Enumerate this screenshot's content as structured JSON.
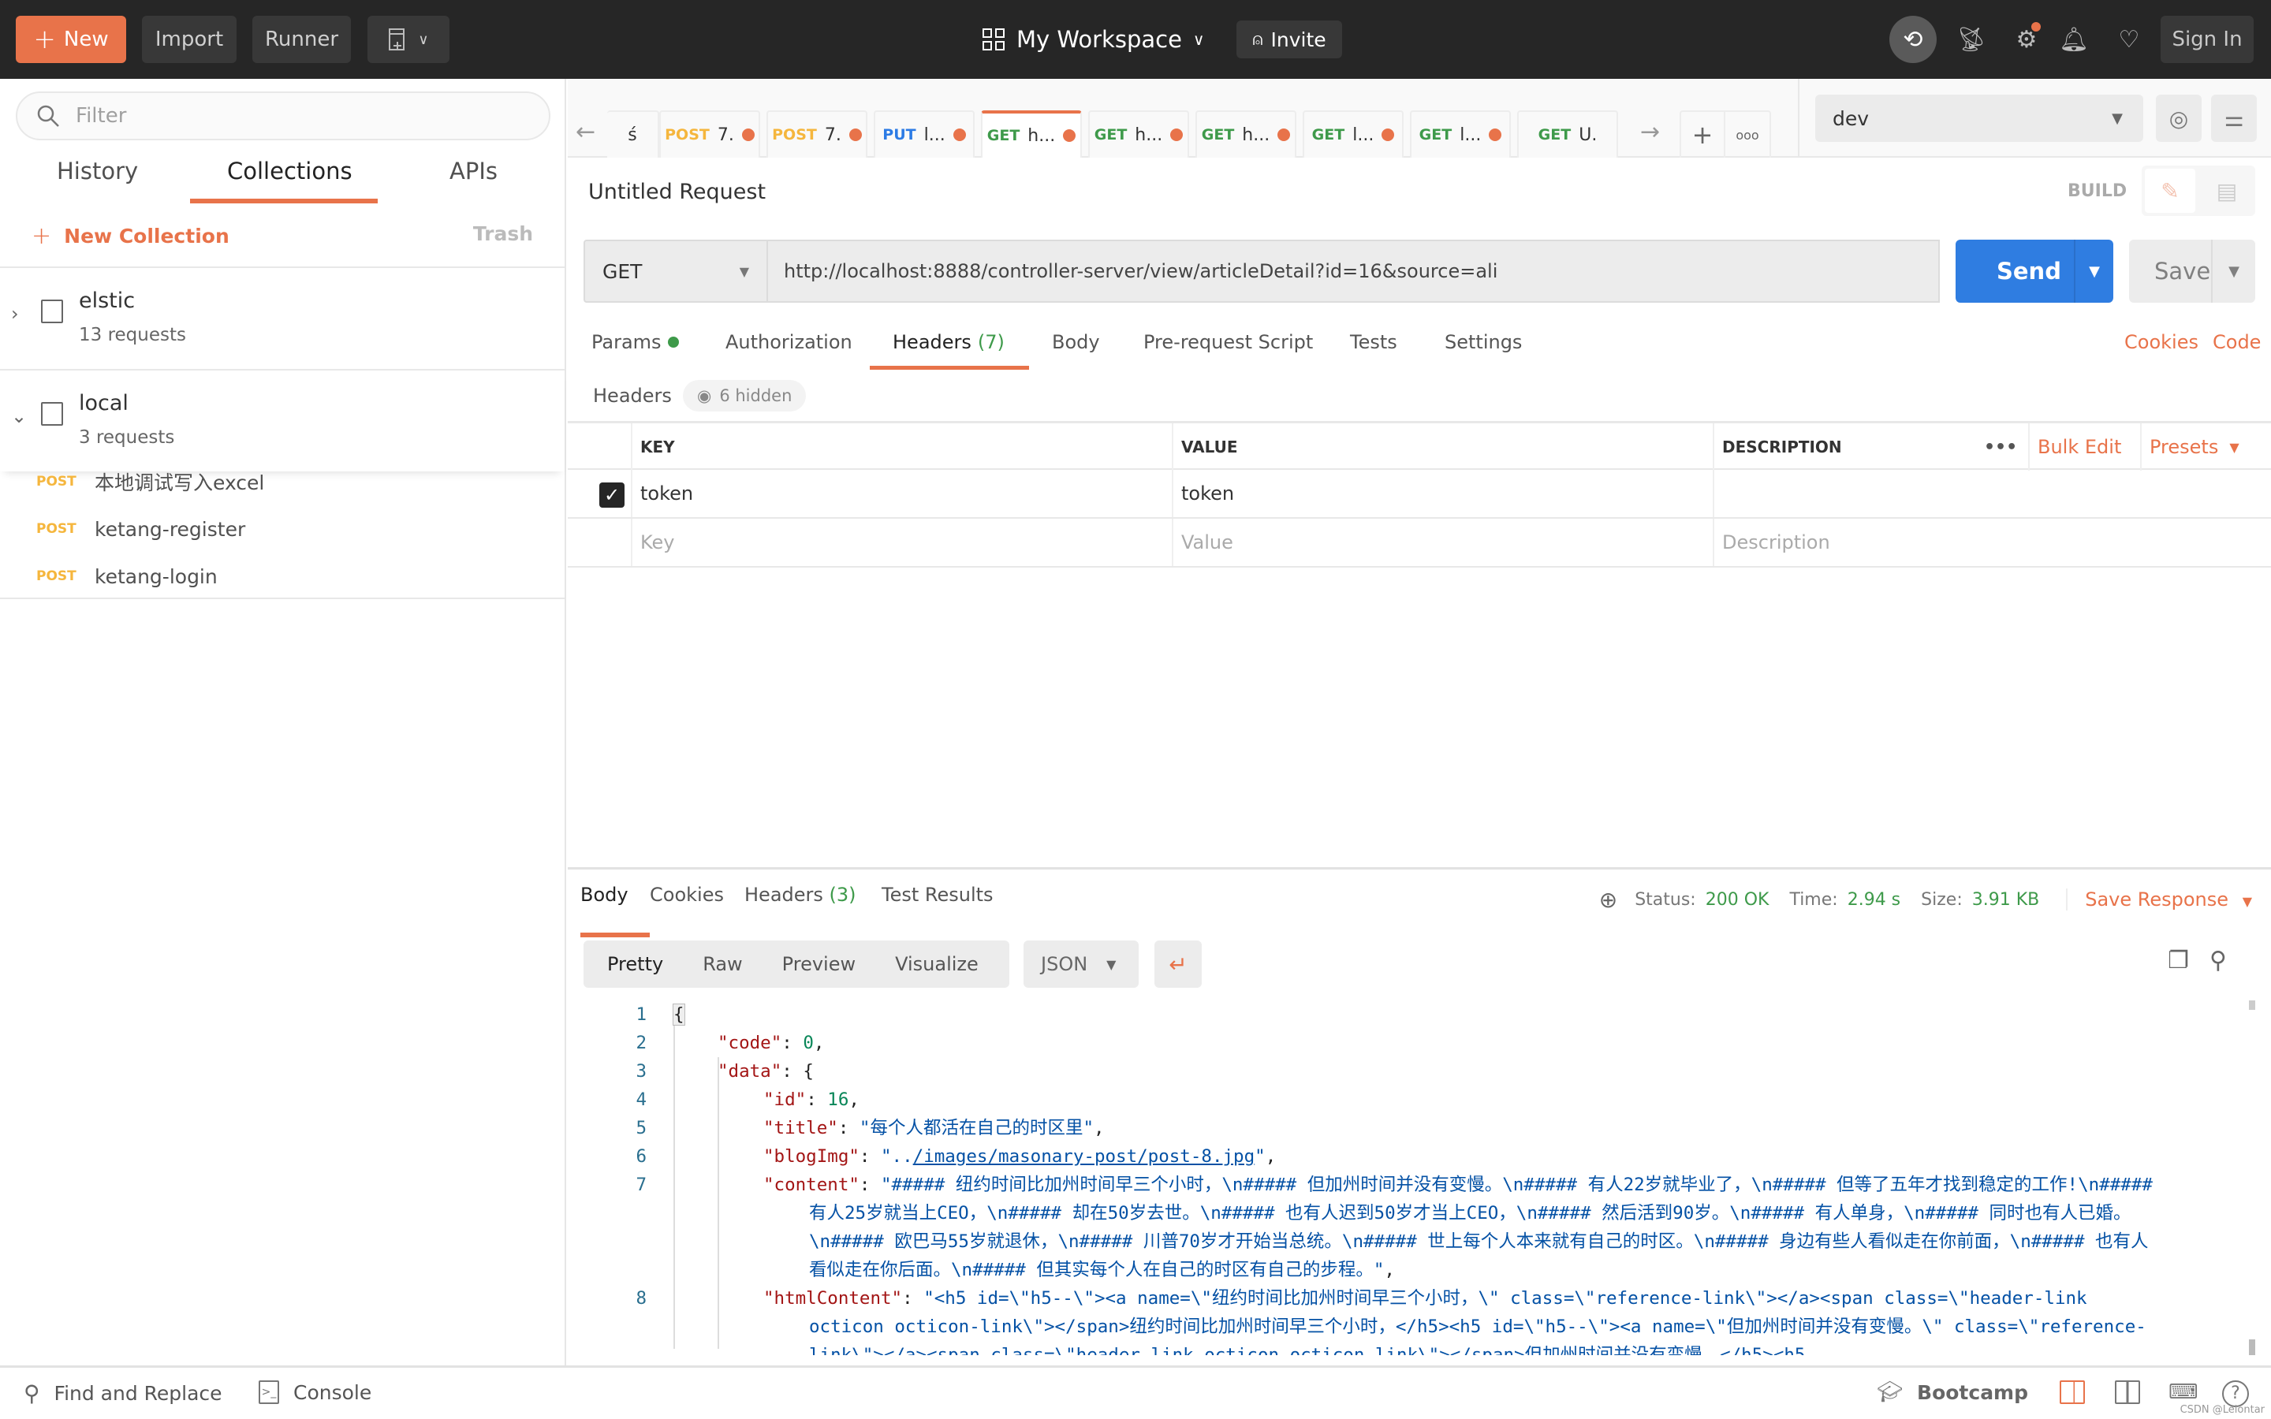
{
  "topbar": {
    "new_label": "New",
    "import_label": "Import",
    "runner_label": "Runner",
    "workspace_label": "My Workspace",
    "invite_label": "Invite",
    "signin_label": "Sign In",
    "icons": [
      "plus-icon",
      "new-window-icon",
      "workspace-grid-icon",
      "chevron-down-icon",
      "add-user-icon",
      "sync-off-icon",
      "satellite-icon",
      "settings-icon",
      "bell-icon",
      "heart-icon"
    ],
    "accent_color": "#e8734a"
  },
  "sidebar": {
    "filter_placeholder": "Filter",
    "tabs": [
      {
        "label": "History",
        "active": false
      },
      {
        "label": "Collections",
        "active": true
      },
      {
        "label": "APIs",
        "active": false
      }
    ],
    "new_collection_label": "New Collection",
    "trash_label": "Trash",
    "collections": [
      {
        "name": "elstic",
        "count": "13 requests",
        "expanded": false
      },
      {
        "name": "local",
        "count": "3 requests",
        "expanded": true
      }
    ],
    "requests": [
      {
        "method": "POST",
        "name": "本地调试写入excel"
      },
      {
        "method": "POST",
        "name": "ketang-register"
      },
      {
        "method": "POST",
        "name": "ketang-login"
      }
    ]
  },
  "request_tabs": [
    {
      "method": "",
      "name": "ś",
      "modified": false,
      "active": false
    },
    {
      "method": "POST",
      "name": "7.",
      "modified": true,
      "active": false
    },
    {
      "method": "POST",
      "name": "7.",
      "modified": true,
      "active": false
    },
    {
      "method": "PUT",
      "name": "l...",
      "modified": true,
      "active": false
    },
    {
      "method": "GET",
      "name": "h...",
      "modified": true,
      "active": true
    },
    {
      "method": "GET",
      "name": "h...",
      "modified": true,
      "active": false
    },
    {
      "method": "GET",
      "name": "h...",
      "modified": true,
      "active": false
    },
    {
      "method": "GET",
      "name": "l...",
      "modified": true,
      "active": false
    },
    {
      "method": "GET",
      "name": "l...",
      "modified": true,
      "active": false
    },
    {
      "method": "GET",
      "name": "U.",
      "modified": false,
      "active": false
    }
  ],
  "environment": {
    "selected": "dev"
  },
  "request": {
    "title": "Untitled Request",
    "build_label": "BUILD",
    "method": "GET",
    "url": "http://localhost:8888/controller-server/view/articleDetail?id=16&source=ali",
    "send_label": "Send",
    "save_label": "Save",
    "tabs": [
      {
        "label": "Params",
        "badge": "dot"
      },
      {
        "label": "Authorization"
      },
      {
        "label": "Headers",
        "count": "(7)",
        "active": true
      },
      {
        "label": "Body"
      },
      {
        "label": "Pre-request Script"
      },
      {
        "label": "Tests"
      },
      {
        "label": "Settings"
      }
    ],
    "cookies_label": "Cookies",
    "code_label": "Code"
  },
  "headers": {
    "label": "Headers",
    "hidden_label": "6 hidden",
    "columns": {
      "key": "KEY",
      "value": "VALUE",
      "description": "DESCRIPTION"
    },
    "bulk_edit_label": "Bulk Edit",
    "presets_label": "Presets",
    "rows": [
      {
        "checked": true,
        "key": "token",
        "value": "token",
        "description": ""
      }
    ],
    "placeholders": {
      "key": "Key",
      "value": "Value",
      "description": "Description"
    }
  },
  "response": {
    "tabs": [
      {
        "label": "Body",
        "active": true
      },
      {
        "label": "Cookies"
      },
      {
        "label": "Headers",
        "count": "(3)"
      },
      {
        "label": "Test Results"
      }
    ],
    "status_label": "Status:",
    "status_value": "200 OK",
    "time_label": "Time:",
    "time_value": "2.94 s",
    "size_label": "Size:",
    "size_value": "3.91 KB",
    "save_response_label": "Save Response",
    "view_modes": [
      "Pretty",
      "Raw",
      "Preview",
      "Visualize"
    ],
    "format": "JSON",
    "lines": [
      {
        "n": "1"
      },
      {
        "n": "2"
      },
      {
        "n": "3"
      },
      {
        "n": "4"
      },
      {
        "n": "5"
      },
      {
        "n": "6"
      },
      {
        "n": "7"
      },
      {
        "n": "8"
      }
    ],
    "json": {
      "code_key": "\"code\"",
      "code_val": "0",
      "data_key": "\"data\"",
      "id_key": "\"id\"",
      "id_val": "16",
      "title_key": "\"title\"",
      "title_val": "\"每个人都活在自己的时区里\"",
      "blogimg_key": "\"blogImg\"",
      "blogimg_pre": "\"..",
      "blogimg_link": "/images/masonary-post/post-8.jpg",
      "blogimg_post": "\"",
      "content_key": "\"content\"",
      "content_val": "\"##### 纽约时间比加州时间早三个小时，\\n##### 但加州时间并没有变慢。\\n##### 有人22岁就毕业了，\\n##### 但等了五年才找到稳定的工作!\\n##### 有人25岁就当上CEO，\\n##### 却在50岁去世。\\n##### 也有人迟到50岁才当上CEO，\\n##### 然后活到90岁。\\n##### 有人单身，\\n##### 同时也有人已婚。\\n##### 欧巴马55岁就退休，\\n##### 川普70岁才开始当总统。\\n##### 世上每个人本来就有自己的时区。\\n##### 身边有些人看似走在你前面，\\n##### 也有人看似走在你后面。\\n##### 但其实每个人在自己的时区有自己的步程。\"",
      "html_key": "\"htmlContent\"",
      "html_val": "\"<h5 id=\\\"h5--\\\"><a name=\\\"纽约时间比加州时间早三个小时，\\\" class=\\\"reference-link\\\"></a><span class=\\\"header-link octicon octicon-link\\\"></span>纽约时间比加州时间早三个小时，</h5><h5 id=\\\"h5--\\\"><a name=\\\"但加州时间并没有变慢。\\\" class=\\\"reference-link\\\"></a><span class=\\\"header-link octicon octicon-link\\\"></span>但加州时间并没有变慢。</h5><h5"
    }
  },
  "footer": {
    "find_replace_label": "Find and Replace",
    "console_label": "Console",
    "bootcamp_label": "Bootcamp",
    "watermark": "CSDN @Lelontar"
  }
}
